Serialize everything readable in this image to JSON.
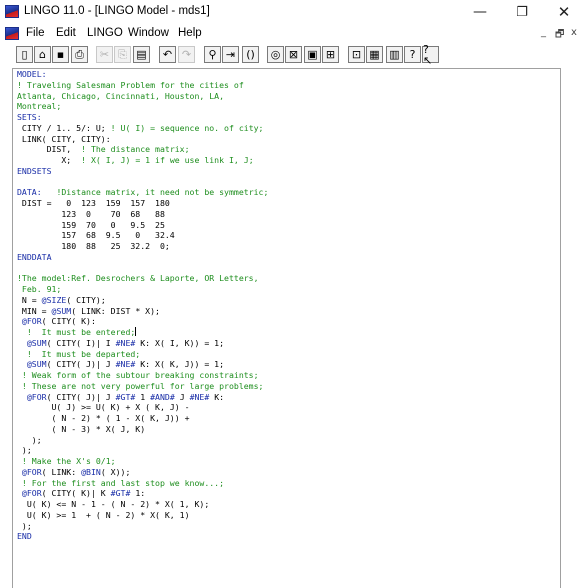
{
  "window": {
    "title": "LINGO 11.0 - [LINGO Model - mds1]",
    "app_icon": "lingo-app-icon",
    "controls": {
      "minimize": "—",
      "maximize": "❐",
      "close": "✕"
    }
  },
  "menubar": {
    "items": [
      "File",
      "Edit",
      "LINGO",
      "Window",
      "Help"
    ],
    "mdi_controls": {
      "minimize": "_",
      "restore": "🗗",
      "close": "x"
    }
  },
  "toolbar": {
    "buttons": [
      {
        "name": "new-icon",
        "glyph": "▯",
        "enabled": true
      },
      {
        "name": "open-icon",
        "glyph": "⌂",
        "enabled": true
      },
      {
        "name": "save-icon",
        "glyph": "▪",
        "enabled": true
      },
      {
        "name": "print-icon",
        "glyph": "⎙",
        "enabled": true
      },
      {
        "name": "cut-icon",
        "glyph": "✂",
        "enabled": false
      },
      {
        "name": "copy-icon",
        "glyph": "⎘",
        "enabled": false
      },
      {
        "name": "paste-icon",
        "glyph": "▤",
        "enabled": true
      },
      {
        "name": "undo-icon",
        "glyph": "↶",
        "enabled": true
      },
      {
        "name": "redo-icon",
        "glyph": "↷",
        "enabled": false
      },
      {
        "name": "find-icon",
        "glyph": "⚲",
        "enabled": true
      },
      {
        "name": "goto-line-icon",
        "glyph": "⇥",
        "enabled": true
      },
      {
        "name": "match-paren-icon",
        "glyph": "()",
        "enabled": true
      },
      {
        "name": "solve-icon",
        "glyph": "◎",
        "enabled": true
      },
      {
        "name": "solution-icon",
        "glyph": "⊠",
        "enabled": true
      },
      {
        "name": "matrix-picture-icon",
        "glyph": "▣",
        "enabled": true
      },
      {
        "name": "options-icon",
        "glyph": "⊞",
        "enabled": true
      },
      {
        "name": "send-to-back-icon",
        "glyph": "⊡",
        "enabled": true
      },
      {
        "name": "close-all-icon",
        "glyph": "▦",
        "enabled": true
      },
      {
        "name": "tile-icon",
        "glyph": "▥",
        "enabled": true
      },
      {
        "name": "help-icon",
        "glyph": "?",
        "enabled": true
      },
      {
        "name": "context-help-icon",
        "glyph": "?↖",
        "enabled": true
      }
    ]
  },
  "colors": {
    "keyword": "#1a2ea8",
    "comment": "#1e8e1e",
    "text": "#000000"
  },
  "editor": {
    "lines": [
      [
        {
          "t": "MODEL:",
          "c": "k"
        }
      ],
      [
        {
          "t": "! Traveling Salesman Problem for the cities of",
          "c": "c"
        }
      ],
      [
        {
          "t": "Atlanta, Chicago, Cincinnati, Houston, LA,",
          "c": "c"
        }
      ],
      [
        {
          "t": "Montreal;",
          "c": "c"
        }
      ],
      [
        {
          "t": "SETS:",
          "c": "k"
        }
      ],
      [
        {
          "t": " CITY / 1.. 5/: U; ",
          "c": "x"
        },
        {
          "t": "! U( I) = sequence no. of city;",
          "c": "c"
        }
      ],
      [
        {
          "t": " LINK( CITY, CITY):",
          "c": "x"
        }
      ],
      [
        {
          "t": "      DIST,  ",
          "c": "x"
        },
        {
          "t": "! The distance matrix;",
          "c": "c"
        }
      ],
      [
        {
          "t": "         X;  ",
          "c": "x"
        },
        {
          "t": "! X( I, J) = 1 if we use link I, J;",
          "c": "c"
        }
      ],
      [
        {
          "t": "ENDSETS",
          "c": "k"
        }
      ],
      [
        {
          "t": "",
          "c": "x"
        }
      ],
      [
        {
          "t": "DATA:",
          "c": "k"
        },
        {
          "t": "   ",
          "c": "x"
        },
        {
          "t": "!Distance matrix, it need not be symmetric;",
          "c": "c"
        }
      ],
      [
        {
          "t": " DIST =   0  123  159  157  180",
          "c": "x"
        }
      ],
      [
        {
          "t": "         123  0    70  68   88",
          "c": "x"
        }
      ],
      [
        {
          "t": "         159  70   0   9.5  25",
          "c": "x"
        }
      ],
      [
        {
          "t": "         157  68  9.5   0   32.4",
          "c": "x"
        }
      ],
      [
        {
          "t": "         180  88   25  32.2  0;",
          "c": "x"
        }
      ],
      [
        {
          "t": "ENDDATA",
          "c": "k"
        }
      ],
      [
        {
          "t": "",
          "c": "x"
        }
      ],
      [
        {
          "t": "!The model:Ref. Desrochers & Laporte, OR Letters,",
          "c": "c"
        }
      ],
      [
        {
          "t": " Feb. 91;",
          "c": "c"
        }
      ],
      [
        {
          "t": " N = ",
          "c": "x"
        },
        {
          "t": "@SIZE",
          "c": "k"
        },
        {
          "t": "( CITY);",
          "c": "x"
        }
      ],
      [
        {
          "t": " MIN = ",
          "c": "x"
        },
        {
          "t": "@SUM",
          "c": "k"
        },
        {
          "t": "( LINK: DIST * X);",
          "c": "x"
        }
      ],
      [
        {
          "t": " @FOR",
          "c": "k"
        },
        {
          "t": "( CITY( K):",
          "c": "x"
        }
      ],
      [
        {
          "t": "  !  It must be entered;",
          "c": "c"
        },
        {
          "t": "|",
          "c": "caret"
        }
      ],
      [
        {
          "t": "  ",
          "c": "x"
        },
        {
          "t": "@SUM",
          "c": "k"
        },
        {
          "t": "( CITY( I)| I ",
          "c": "x"
        },
        {
          "t": "#NE#",
          "c": "k"
        },
        {
          "t": " K: X( I, K)) = 1;",
          "c": "x"
        }
      ],
      [
        {
          "t": "  !  It must be departed;",
          "c": "c"
        }
      ],
      [
        {
          "t": "  ",
          "c": "x"
        },
        {
          "t": "@SUM",
          "c": "k"
        },
        {
          "t": "( CITY( J)| J ",
          "c": "x"
        },
        {
          "t": "#NE#",
          "c": "k"
        },
        {
          "t": " K: X( K, J)) = 1;",
          "c": "x"
        }
      ],
      [
        {
          "t": " ! Weak form of the subtour breaking constraints;",
          "c": "c"
        }
      ],
      [
        {
          "t": " ! These are not very powerful for large problems;",
          "c": "c"
        }
      ],
      [
        {
          "t": "  ",
          "c": "x"
        },
        {
          "t": "@FOR",
          "c": "k"
        },
        {
          "t": "( CITY( J)| J ",
          "c": "x"
        },
        {
          "t": "#GT#",
          "c": "k"
        },
        {
          "t": " 1 ",
          "c": "x"
        },
        {
          "t": "#AND#",
          "c": "k"
        },
        {
          "t": " J ",
          "c": "x"
        },
        {
          "t": "#NE#",
          "c": "k"
        },
        {
          "t": " K:",
          "c": "x"
        }
      ],
      [
        {
          "t": "       U( J) >= U( K) + X ( K, J) -",
          "c": "x"
        }
      ],
      [
        {
          "t": "       ( N - 2) * ( 1 - X( K, J)) +",
          "c": "x"
        }
      ],
      [
        {
          "t": "       ( N - 3) * X( J, K)",
          "c": "x"
        }
      ],
      [
        {
          "t": "   );",
          "c": "x"
        }
      ],
      [
        {
          "t": " );",
          "c": "x"
        }
      ],
      [
        {
          "t": " ! Make the X's 0/1;",
          "c": "c"
        }
      ],
      [
        {
          "t": " @FOR",
          "c": "k"
        },
        {
          "t": "( LINK: ",
          "c": "x"
        },
        {
          "t": "@BIN",
          "c": "k"
        },
        {
          "t": "( X));",
          "c": "x"
        }
      ],
      [
        {
          "t": " ! For the first and last stop we know...;",
          "c": "c"
        }
      ],
      [
        {
          "t": " @FOR",
          "c": "k"
        },
        {
          "t": "( CITY( K)| K ",
          "c": "x"
        },
        {
          "t": "#GT#",
          "c": "k"
        },
        {
          "t": " 1:",
          "c": "x"
        }
      ],
      [
        {
          "t": "  U( K) <= N - 1 - ( N - 2) * X( 1, K);",
          "c": "x"
        }
      ],
      [
        {
          "t": "  U( K) >= 1  + ( N - 2) * X( K, 1)",
          "c": "x"
        }
      ],
      [
        {
          "t": " );",
          "c": "x"
        }
      ],
      [
        {
          "t": "END",
          "c": "k"
        }
      ]
    ]
  }
}
